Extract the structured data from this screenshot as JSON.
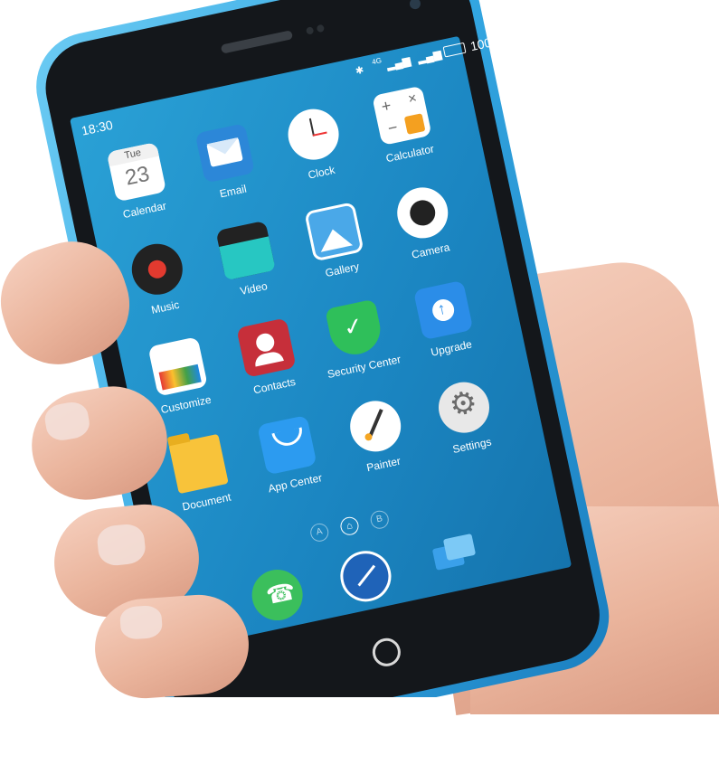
{
  "status_bar": {
    "time": "18:30",
    "battery": "100",
    "network": "4G"
  },
  "apps": [
    {
      "label": "Calendar",
      "icon": "calendar-icon",
      "day": "Tue",
      "date": "23"
    },
    {
      "label": "Email",
      "icon": "email-icon"
    },
    {
      "label": "Clock",
      "icon": "clock-icon"
    },
    {
      "label": "Calculator",
      "icon": "calculator-icon"
    },
    {
      "label": "Music",
      "icon": "music-icon"
    },
    {
      "label": "Video",
      "icon": "video-icon"
    },
    {
      "label": "Gallery",
      "icon": "gallery-icon"
    },
    {
      "label": "Camera",
      "icon": "camera-icon"
    },
    {
      "label": "Customize",
      "icon": "customize-icon"
    },
    {
      "label": "Contacts",
      "icon": "contacts-icon"
    },
    {
      "label": "Security Center",
      "icon": "shield-icon"
    },
    {
      "label": "Upgrade",
      "icon": "upgrade-icon"
    },
    {
      "label": "Document",
      "icon": "folder-icon"
    },
    {
      "label": "App Center",
      "icon": "app-center-icon"
    },
    {
      "label": "Painter",
      "icon": "painter-icon"
    },
    {
      "label": "Settings",
      "icon": "gear-icon"
    }
  ],
  "page_indicator": {
    "left": "A",
    "right": "B"
  },
  "dock": [
    {
      "icon": "phone-icon"
    },
    {
      "icon": "compass-icon"
    },
    {
      "icon": "messages-icon"
    }
  ],
  "colors": {
    "phone_body": "#3fb2ea",
    "bezel": "#111418",
    "screen": "#1c8cc6",
    "skin": "#eab49c"
  }
}
